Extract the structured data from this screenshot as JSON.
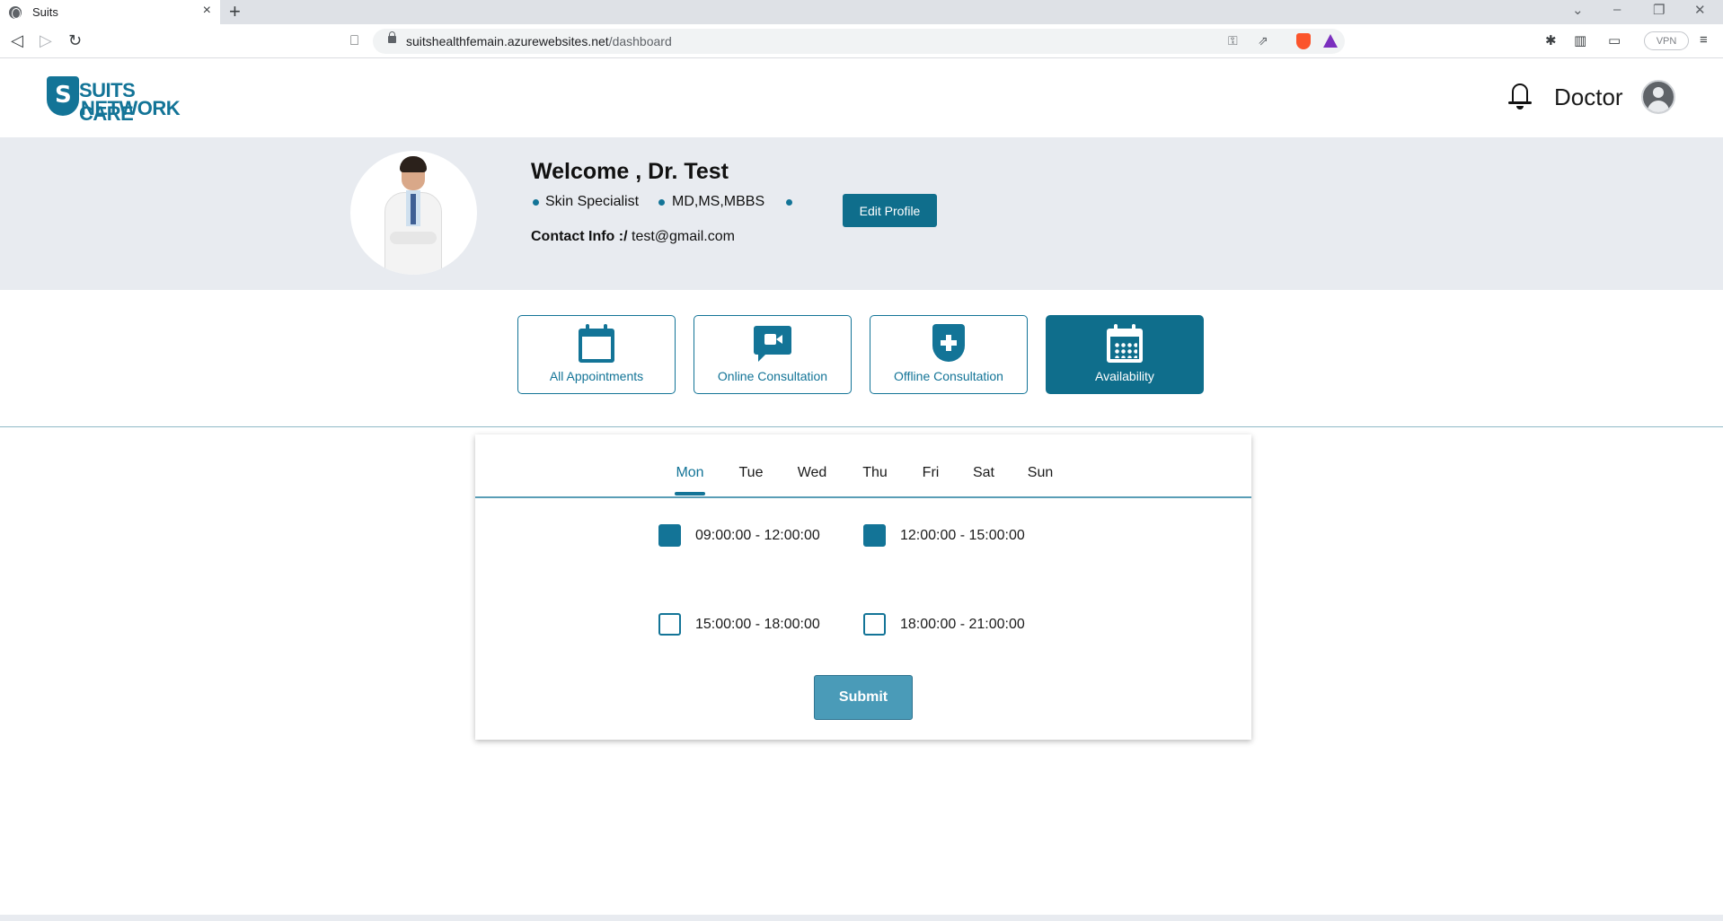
{
  "browser": {
    "tab_title": "Suits",
    "url_host": "suitshealthfemain.azurewebsites.net",
    "url_path": "/dashboard",
    "vpn_label": "VPN"
  },
  "header": {
    "logo_line1": "SUITS CARE",
    "logo_line2": "NETWORK",
    "role_label": "Doctor"
  },
  "profile": {
    "welcome": "Welcome , Dr. Test",
    "specialty": "Skin Specialist",
    "degrees": "MD,MS,MBBS",
    "contact_label": "Contact Info :/",
    "contact_value": " test@gmail.com",
    "edit_button": "Edit Profile"
  },
  "nav_cards": [
    {
      "label": "All Appointments",
      "icon": "calendar-icon",
      "active": false
    },
    {
      "label": "Online Consultation",
      "icon": "video-chat-icon",
      "active": false
    },
    {
      "label": "Offline Consultation",
      "icon": "medical-shield-icon",
      "active": false
    },
    {
      "label": "Availability",
      "icon": "calendar-grid-icon",
      "active": true
    }
  ],
  "availability": {
    "days": [
      "Mon",
      "Tue",
      "Wed",
      "Thu",
      "Fri",
      "Sat",
      "Sun"
    ],
    "active_day": "Mon",
    "slots": [
      {
        "label": "09:00:00 - 12:00:00",
        "checked": true
      },
      {
        "label": "12:00:00 - 15:00:00",
        "checked": true
      },
      {
        "label": "15:00:00 - 18:00:00",
        "checked": false
      },
      {
        "label": "18:00:00 - 21:00:00",
        "checked": false
      }
    ],
    "submit_label": "Submit"
  },
  "colors": {
    "brand": "#137497",
    "button": "#0f6e8c",
    "banner_bg": "#e8ebf0",
    "submit_bg": "#4a9bb8"
  }
}
